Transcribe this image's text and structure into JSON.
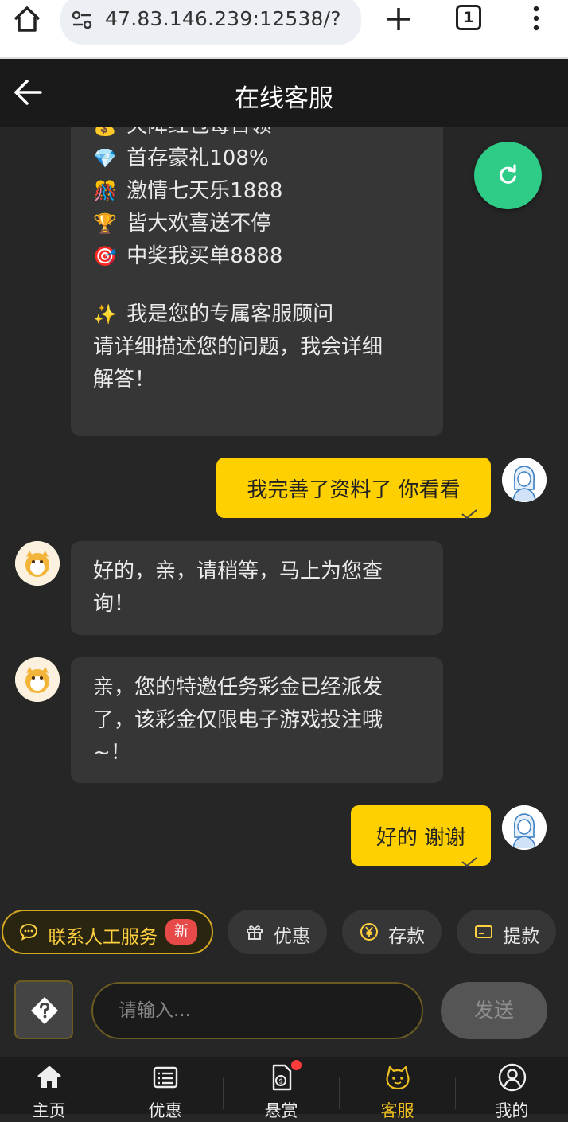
{
  "browser": {
    "url": "47.83.146.239:12538/?",
    "tab_count": "1"
  },
  "header": {
    "title": "在线客服"
  },
  "chat": {
    "first_bubble": {
      "lines": [
        {
          "emoji": "💰",
          "text": "天降红包每日领"
        },
        {
          "emoji": "💎",
          "text": "首存豪礼108%"
        },
        {
          "emoji": "🎊",
          "text": "激情七天乐1888"
        },
        {
          "emoji": "🏆",
          "text": "皆大欢喜送不停"
        },
        {
          "emoji": "🎯",
          "text": "中奖我买单8888"
        }
      ],
      "intro_emoji": "✨",
      "intro": "我是您的专属客服顾问",
      "prompt_line1": "请详细描述您的问题，我会详细",
      "prompt_line2": "解答！"
    },
    "messages": [
      {
        "from": "user",
        "text": "我完善了资料了 你看看"
      },
      {
        "from": "agent",
        "line1": "好的，亲，请稍等，马上为您查",
        "line2": "询！"
      },
      {
        "from": "agent",
        "line1": "亲，您的特邀任务彩金已经派发",
        "line2": "了，该彩金仅限电子游戏投注哦",
        "line3": "~！"
      },
      {
        "from": "user",
        "text": "好的 谢谢"
      }
    ]
  },
  "quick_actions": {
    "contact": "联系人工服务",
    "contact_badge": "新",
    "promo": "优惠",
    "deposit": "存款",
    "withdraw": "提款"
  },
  "input": {
    "placeholder": "请输入...",
    "send": "发送"
  },
  "nav": {
    "home": "主页",
    "promo": "优惠",
    "reward": "悬赏",
    "service": "客服",
    "mine": "我的"
  },
  "colors": {
    "accent": "#ffd000",
    "refresh": "#2ecc87",
    "badge": "#e84a4a",
    "active_nav": "#f0c020"
  }
}
